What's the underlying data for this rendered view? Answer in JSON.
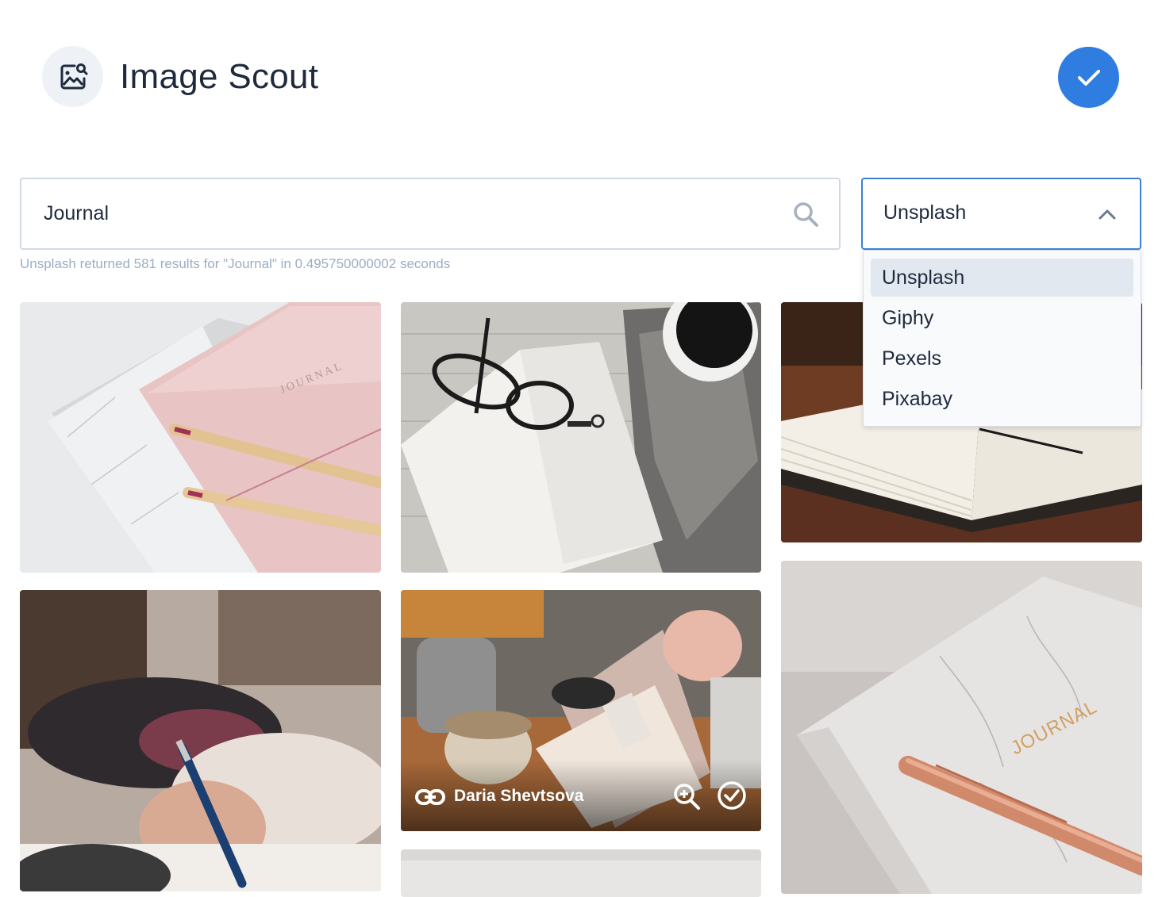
{
  "header": {
    "title": "Image Scout",
    "app_icon": "image-search-icon",
    "confirm_icon": "check-icon",
    "accent_color": "#2f7de1"
  },
  "search": {
    "value": "Journal",
    "icon": "search-icon",
    "results_info": "Unsplash returned 581 results for \"Journal\" in 0.495750000002 seconds"
  },
  "source": {
    "selected": "Unsplash",
    "icon": "chevron-up-icon",
    "options": [
      "Unsplash",
      "Giphy",
      "Pexels",
      "Pixabay"
    ]
  },
  "photos": [
    {
      "subject": "pink and marble journals with pencils"
    },
    {
      "subject": "open notebook with glasses and coffee"
    },
    {
      "subject": "open notebook on wooden table"
    },
    {
      "subject": "person writing in notebook"
    },
    {
      "subject": "notebook and tea cups",
      "author": "Daria Shevtsova",
      "link_icon": "link-icon",
      "zoom_icon": "zoom-in-icon",
      "select_icon": "check-circle-icon"
    },
    {
      "subject": "marble journal with rose gold pen"
    },
    {
      "subject": "light photo"
    }
  ]
}
